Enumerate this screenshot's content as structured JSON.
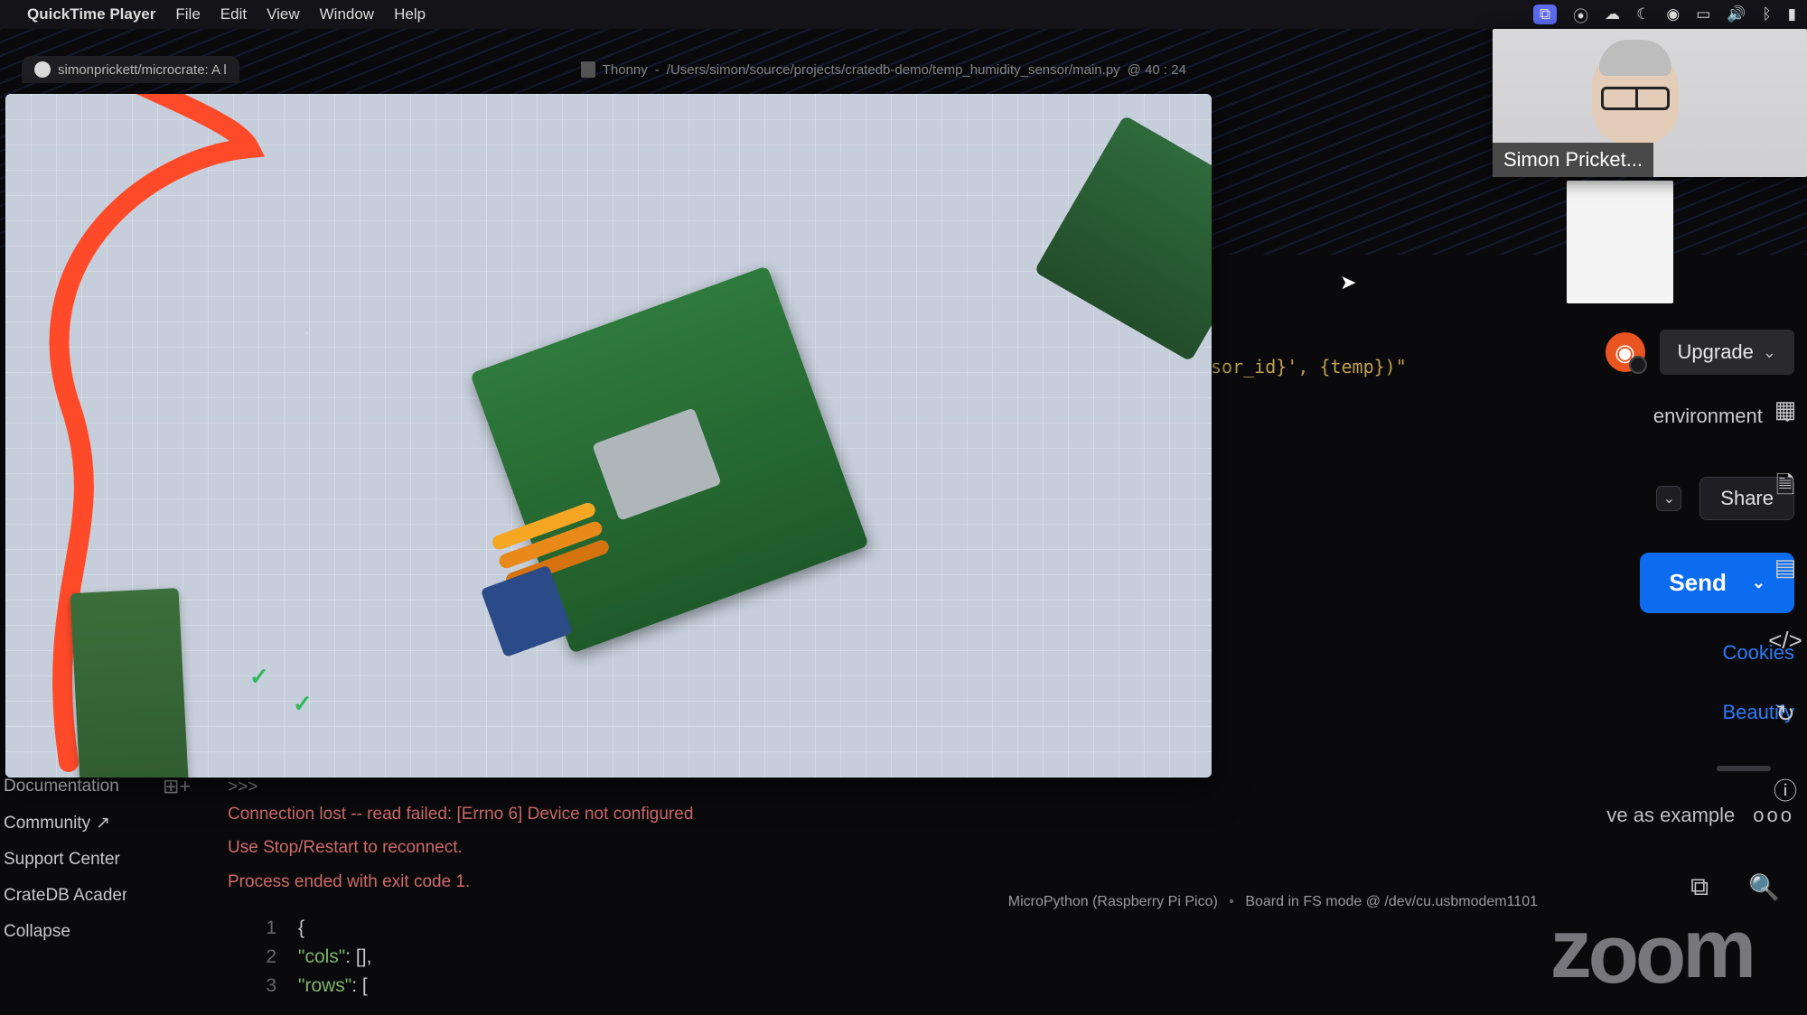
{
  "menubar": {
    "app": "QuickTime Player",
    "items": [
      "File",
      "Edit",
      "View",
      "Window",
      "Help"
    ]
  },
  "browser_tab": {
    "title": "simonprickett/microcrate: A l"
  },
  "editor_tab": {
    "app": "Thonny",
    "path": "/Users/simon/source/projects/cratedb-demo/temp_humidity_sensor/main.py",
    "cursor": "@  40 : 24"
  },
  "code_fragment": "sor_id}', {temp})\"",
  "sidebar": {
    "items": [
      "Documentation",
      "Community",
      "Support Center",
      "CrateDB Academy",
      "Collapse"
    ]
  },
  "terminal": {
    "prompt": ">>>",
    "lines": [
      "Connection lost -- read failed: [Errno 6] Device not configured",
      "Use Stop/Restart to reconnect.",
      "Process ended with exit code 1."
    ]
  },
  "statusbar": {
    "interpreter": "MicroPython (Raspberry Pi Pico)",
    "board": "Board in FS mode @ /dev/cu.usbmodem1101"
  },
  "json_output": {
    "line_numbers": [
      "1",
      "2",
      "3"
    ],
    "lines": [
      {
        "prefix": "{",
        "suffix": ""
      },
      {
        "prefix": "    ",
        "key": "\"cols\"",
        "rest": ": [],"
      },
      {
        "prefix": "    ",
        "key": "\"rows\"",
        "rest": ": ["
      }
    ]
  },
  "right_panel": {
    "upgrade": "Upgrade",
    "environment": "environment",
    "share": "Share",
    "send": "Send",
    "cookies": "Cookies",
    "beautify": "Beautify",
    "save_example": "ve as example"
  },
  "participant": {
    "name": "Simon Pricket..."
  },
  "zoom_watermark": "zoom"
}
